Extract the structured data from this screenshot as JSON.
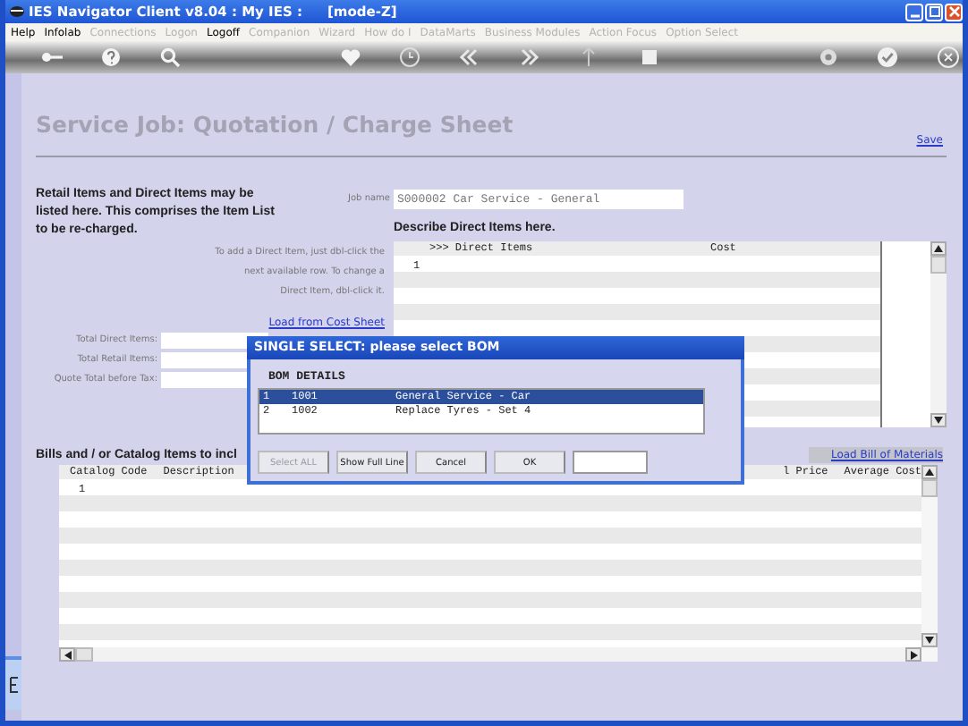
{
  "window": {
    "title": "IES Navigator Client v8.04 : My IES :",
    "mode": "[mode-Z]"
  },
  "menu": [
    {
      "label": "Help",
      "disabled": false
    },
    {
      "label": "Infolab",
      "disabled": false
    },
    {
      "label": "Connections",
      "disabled": true
    },
    {
      "label": "Logon",
      "disabled": true
    },
    {
      "label": "Logoff",
      "disabled": false
    },
    {
      "label": "Companion",
      "disabled": true
    },
    {
      "label": "Wizard",
      "disabled": true
    },
    {
      "label": "How do I",
      "disabled": true
    },
    {
      "label": "DataMarts",
      "disabled": true
    },
    {
      "label": "Business Modules",
      "disabled": true
    },
    {
      "label": "Action Focus",
      "disabled": true
    },
    {
      "label": "Option Select",
      "disabled": true
    }
  ],
  "page": {
    "title": "Service Job: Quotation / Charge Sheet",
    "save_link": "Save"
  },
  "intro": "Retail Items and Direct Items may be listed here. This comprises the Item List to be re-charged.",
  "job_name": {
    "label": "Job name",
    "value": "S000002 Car Service - General"
  },
  "direct_items": {
    "heading": "Describe Direct Items here.",
    "instructions": "To add a Direct Item, just dbl-click the next available row. To change a Direct Item, dbl-click it.",
    "link": "Load from Cost Sheet",
    "columns": [
      ">>> Direct Items",
      "Cost"
    ],
    "rows": [
      {
        "number": "1"
      }
    ]
  },
  "totals": [
    {
      "label": "Total Direct Items:"
    },
    {
      "label": "Total Retail Items:"
    },
    {
      "label": "Quote Total before Tax:"
    }
  ],
  "catalog": {
    "heading": "Bills and / or Catalog Items to incl",
    "link": "Load Bill of Materials",
    "columns": [
      "Catalog Code",
      "Description"
    ],
    "right_columns": [
      "l Price",
      "Average Cost"
    ],
    "rows": [
      {
        "number": "1"
      }
    ]
  },
  "dialog": {
    "title": "SINGLE SELECT: please select BOM",
    "heading": "BOM DETAILS",
    "rows": [
      {
        "number": "1",
        "code": "1001",
        "description": "General Service - Car",
        "selected": true
      },
      {
        "number": "2",
        "code": "1002",
        "description": "Replace Tyres - Set 4",
        "selected": false
      }
    ],
    "buttons": [
      {
        "label": "Select ALL",
        "disabled": true
      },
      {
        "label": "Show Full Line",
        "disabled": false
      },
      {
        "label": "Cancel",
        "disabled": false
      },
      {
        "label": "OK",
        "disabled": false
      }
    ]
  }
}
